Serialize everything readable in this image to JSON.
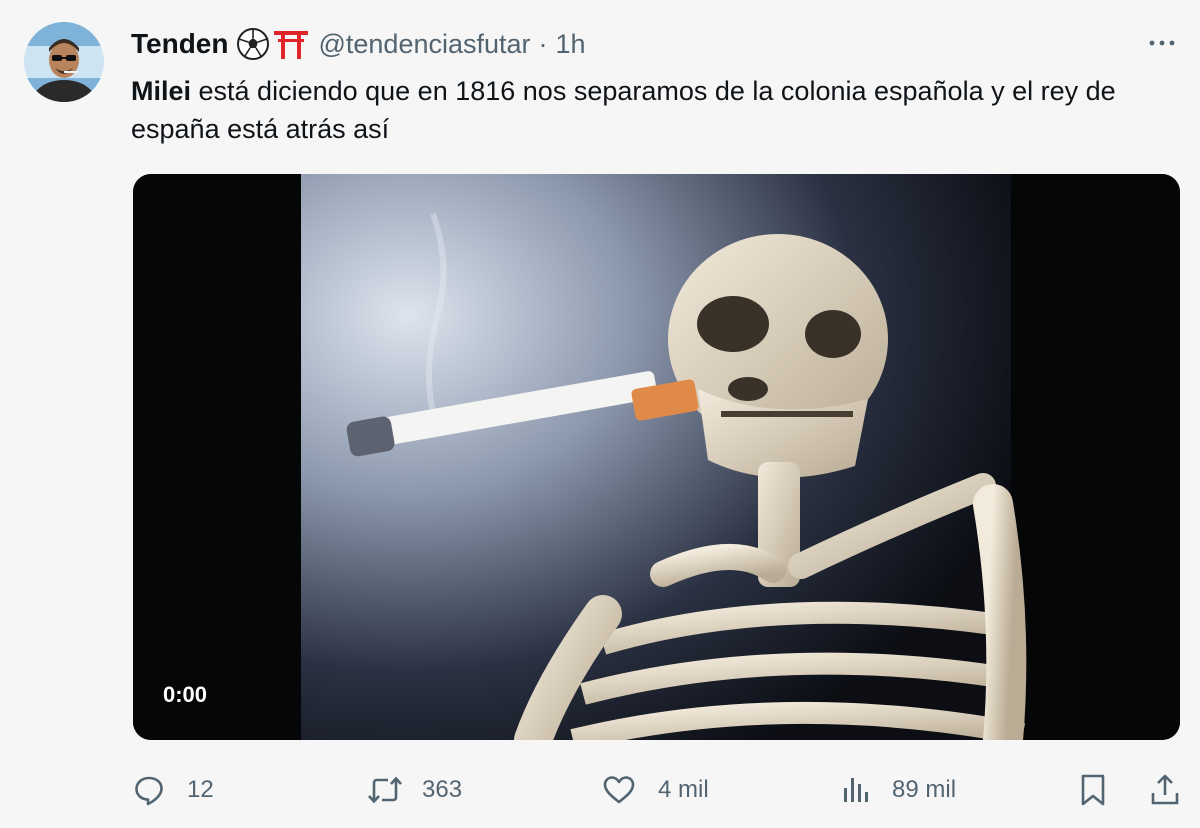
{
  "tweet": {
    "author_name": "Tenden",
    "handle": "@tendenciasfutar",
    "separator": "·",
    "time": "1h",
    "text_bold": "Milei",
    "text_rest": " está diciendo que en 1816 nos separamos de la colonia española y el rey de españa está atrás así"
  },
  "media": {
    "timestamp": "0:00"
  },
  "actions": {
    "replies": "12",
    "reposts": "363",
    "likes": "4 mil",
    "views": "89 mil"
  },
  "icons": {
    "emoji_1": "soccer-ball-icon",
    "emoji_2": "torii-gate-icon",
    "more": "more-icon",
    "reply": "reply-icon",
    "repost": "repost-icon",
    "like": "heart-icon",
    "views": "views-icon",
    "bookmark": "bookmark-icon",
    "share": "share-icon"
  },
  "colors": {
    "background": "#f6f6f6",
    "text": "#0f1419",
    "secondary_text": "#536471",
    "torii_red": "#e0242a"
  }
}
